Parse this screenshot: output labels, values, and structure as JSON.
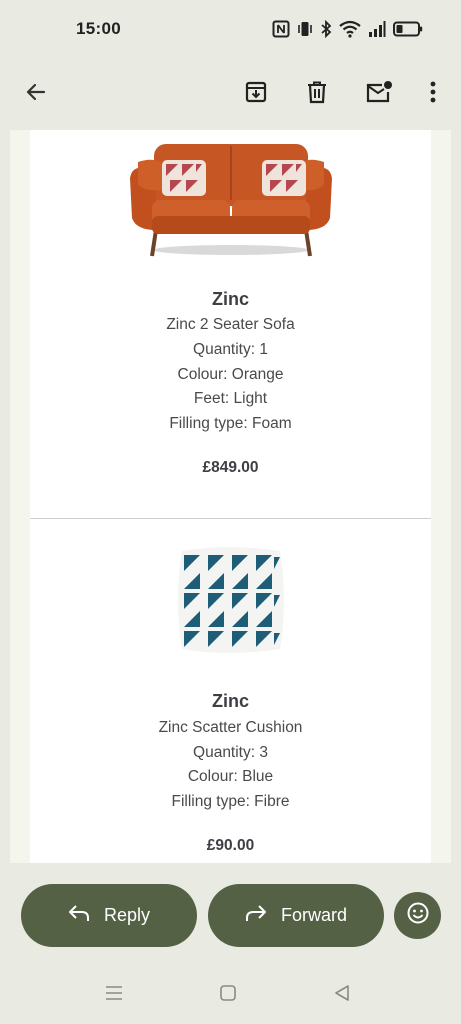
{
  "status_bar": {
    "time": "15:00",
    "icons": [
      "nfc-icon",
      "vibrate-icon",
      "bluetooth-icon",
      "wifi-icon",
      "signal-icon",
      "battery-icon"
    ]
  },
  "app_bar": {
    "icons": [
      "back-arrow-icon",
      "archive-icon",
      "delete-icon",
      "mark-unread-icon",
      "more-vert-icon"
    ]
  },
  "products": [
    {
      "brand": "Zinc",
      "name": "Zinc 2 Seater Sofa",
      "quantity": "Quantity: 1",
      "colour": "Colour: Orange",
      "feet": "Feet: Light",
      "filling": "Filling type: Foam",
      "price": "£849.00",
      "image": "orange-sofa"
    },
    {
      "brand": "Zinc",
      "name": "Zinc Scatter Cushion",
      "quantity": "Quantity: 3",
      "colour": "Colour: Blue",
      "filling": "Filling type: Fibre",
      "price": "£90.00",
      "image": "blue-geometric-cushion"
    }
  ],
  "actions": {
    "reply_label": "Reply",
    "forward_label": "Forward",
    "emoji_icon": "emoji-icon"
  },
  "nav_bar": {
    "icons": [
      "recents-icon",
      "home-icon",
      "back-icon"
    ]
  },
  "colors": {
    "accent": "#556145",
    "background": "#e9ebe2",
    "sofa": "#c4541f",
    "cushion_blue": "#1f5f78"
  }
}
